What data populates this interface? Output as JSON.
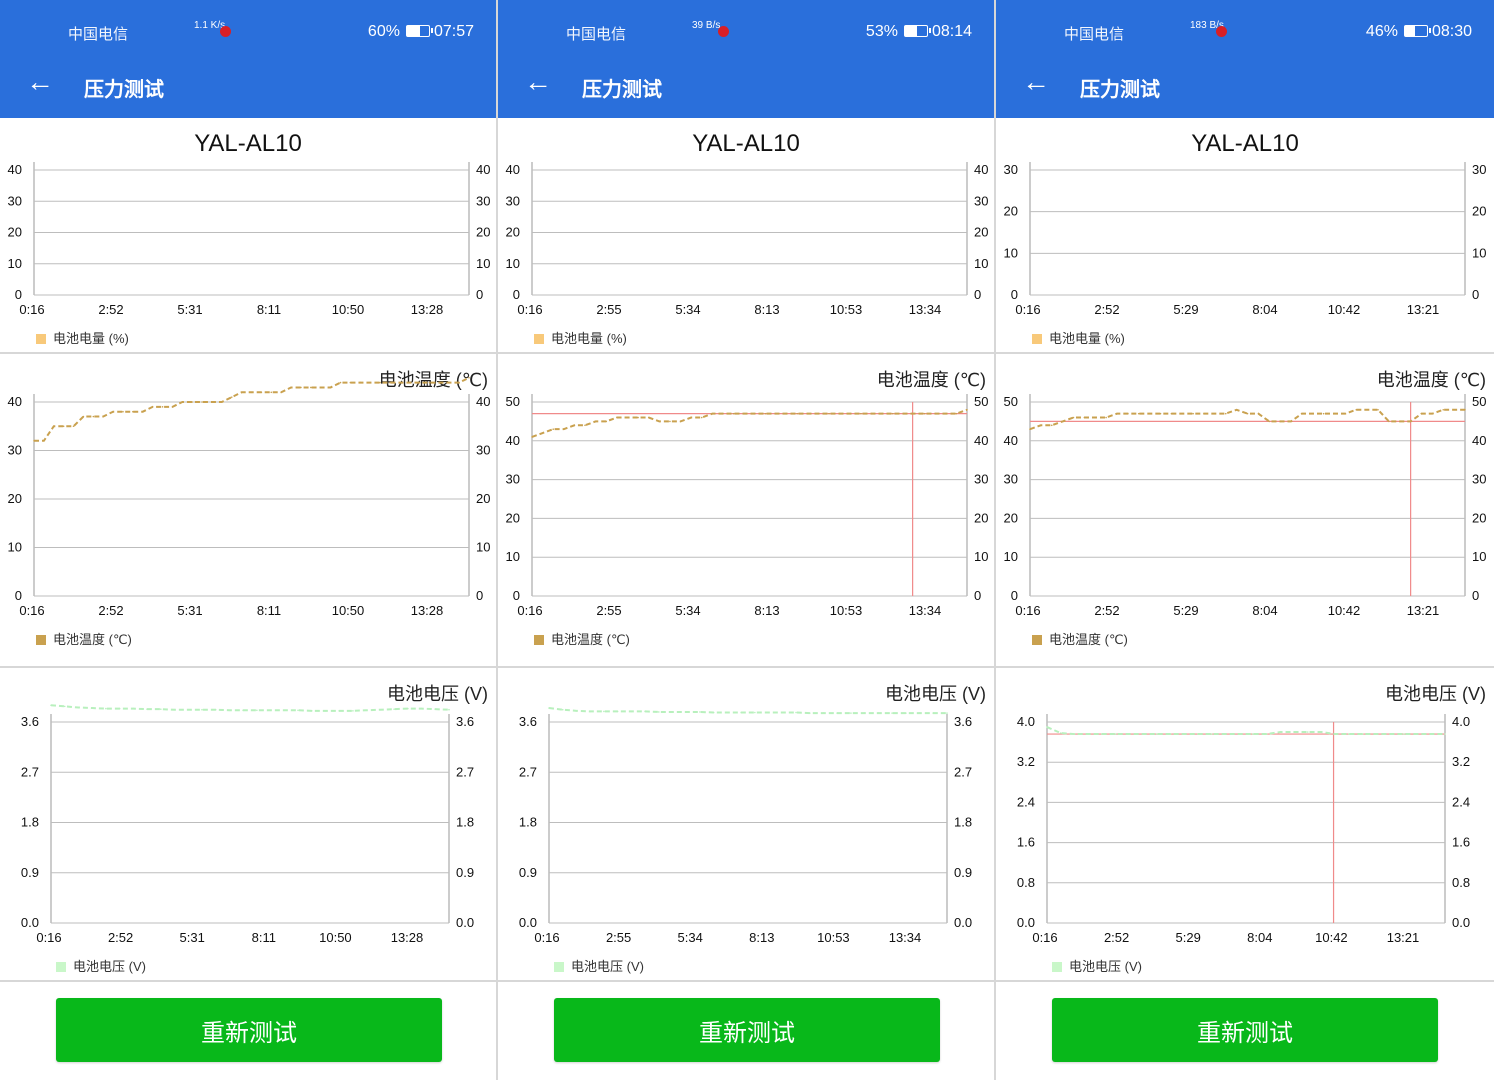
{
  "screens": [
    {
      "status": {
        "carrier": "中国电信",
        "network_speed": "1.1\nK/s",
        "battery": "60%",
        "time": "07:57"
      },
      "header": {
        "title": "压力测试"
      },
      "device": "YAL-AL10",
      "charts": [
        {
          "title": "",
          "legend": "电池电量 (%)",
          "legend_color": "#f8c97a",
          "line_color": "#f8c97a",
          "ylim": [
            0,
            40
          ],
          "ticks": [
            "0",
            "10",
            "20",
            "30",
            "40"
          ],
          "xlabels": [
            "0:16",
            "2:52",
            "5:31",
            "8:11",
            "10:50",
            "13:28"
          ],
          "values": []
        },
        {
          "title": "电池温度 (℃)",
          "legend": "电池温度 (℃)",
          "legend_color": "#c9a14f",
          "line_color": "#c9a14f",
          "ylim": [
            0,
            40
          ],
          "ticks": [
            "0",
            "10",
            "20",
            "30",
            "40"
          ],
          "xlabels": [
            "0:16",
            "2:52",
            "5:31",
            "8:11",
            "10:50",
            "13:28"
          ],
          "values": [
            32,
            32,
            35,
            35,
            35,
            37,
            37,
            37,
            38,
            38,
            38,
            38,
            39,
            39,
            39,
            40,
            40,
            40,
            40,
            40,
            41,
            42,
            42,
            42,
            42,
            42,
            43,
            43,
            43,
            43,
            43,
            44,
            44,
            44,
            44,
            44,
            44,
            44,
            44,
            44,
            44,
            44,
            44,
            44,
            45
          ]
        },
        {
          "title": "电池电压 (V)",
          "legend": "电池电压 (V)",
          "legend_color": "#c9f7c9",
          "line_color": "#b8f0bd",
          "ylim": [
            0,
            3.6
          ],
          "ticks": [
            "0.0",
            "0.9",
            "1.8",
            "2.7",
            "3.6"
          ],
          "xlabels": [
            "0:16",
            "2:52",
            "5:31",
            "8:11",
            "10:50",
            "13:28"
          ],
          "values": [
            3.9,
            3.88,
            3.86,
            3.85,
            3.84,
            3.84,
            3.84,
            3.83,
            3.83,
            3.82,
            3.82,
            3.82,
            3.82,
            3.81,
            3.81,
            3.81,
            3.81,
            3.81,
            3.81,
            3.8,
            3.8,
            3.8,
            3.8,
            3.81,
            3.82,
            3.83,
            3.84,
            3.84,
            3.83,
            3.82
          ]
        }
      ],
      "button": "重新测试"
    },
    {
      "status": {
        "carrier": "中国电信",
        "network_speed": "39\nB/s",
        "battery": "53%",
        "time": "08:14"
      },
      "header": {
        "title": "压力测试"
      },
      "device": "YAL-AL10",
      "charts": [
        {
          "title": "",
          "legend": "电池电量 (%)",
          "legend_color": "#f8c97a",
          "line_color": "#f8c97a",
          "ylim": [
            0,
            40
          ],
          "ticks": [
            "0",
            "10",
            "20",
            "30",
            "40"
          ],
          "xlabels": [
            "0:16",
            "2:55",
            "5:34",
            "8:13",
            "10:53",
            "13:34"
          ],
          "values": []
        },
        {
          "title": "电池温度 (℃)",
          "legend": "电池温度 (℃)",
          "legend_color": "#c9a14f",
          "line_color": "#c9a14f",
          "ylim": [
            0,
            50
          ],
          "ticks": [
            "0",
            "10",
            "20",
            "30",
            "40",
            "50"
          ],
          "xlabels": [
            "0:16",
            "2:55",
            "5:34",
            "8:13",
            "10:53",
            "13:34"
          ],
          "values": [
            41,
            42,
            43,
            43,
            44,
            44,
            45,
            45,
            46,
            46,
            46,
            46,
            45,
            45,
            45,
            46,
            46,
            47,
            47,
            47,
            47,
            47,
            47,
            47,
            47,
            47,
            47,
            47,
            47,
            47,
            47,
            47,
            47,
            47,
            47,
            47,
            47,
            47,
            47,
            47,
            47,
            48
          ],
          "ref_line": 47,
          "crosshair_x": 0.875
        },
        {
          "title": "电池电压 (V)",
          "legend": "电池电压 (V)",
          "legend_color": "#c9f7c9",
          "line_color": "#b8f0bd",
          "ylim": [
            0,
            3.6
          ],
          "ticks": [
            "0.0",
            "0.9",
            "1.8",
            "2.7",
            "3.6"
          ],
          "xlabels": [
            "0:16",
            "2:55",
            "5:34",
            "8:13",
            "10:53",
            "13:34"
          ],
          "values": [
            3.85,
            3.82,
            3.8,
            3.79,
            3.79,
            3.79,
            3.79,
            3.79,
            3.78,
            3.78,
            3.78,
            3.78,
            3.77,
            3.77,
            3.77,
            3.77,
            3.77,
            3.77,
            3.77,
            3.76,
            3.76,
            3.76,
            3.76,
            3.76,
            3.76,
            3.76,
            3.76,
            3.76,
            3.76,
            3.76
          ]
        }
      ],
      "button": "重新测试"
    },
    {
      "status": {
        "carrier": "中国电信",
        "network_speed": "183\nB/s",
        "battery": "46%",
        "time": "08:30"
      },
      "header": {
        "title": "压力测试"
      },
      "device": "YAL-AL10",
      "charts": [
        {
          "title": "",
          "legend": "电池电量 (%)",
          "legend_color": "#f8c97a",
          "line_color": "#f8c97a",
          "ylim": [
            0,
            30
          ],
          "ticks": [
            "0",
            "10",
            "20",
            "30"
          ],
          "xlabels": [
            "0:16",
            "2:52",
            "5:29",
            "8:04",
            "10:42",
            "13:21"
          ],
          "values": []
        },
        {
          "title": "电池温度 (℃)",
          "legend": "电池温度 (℃)",
          "legend_color": "#c9a14f",
          "line_color": "#c9a14f",
          "ylim": [
            0,
            50
          ],
          "ticks": [
            "0",
            "10",
            "20",
            "30",
            "40",
            "50"
          ],
          "xlabels": [
            "0:16",
            "2:52",
            "5:29",
            "8:04",
            "10:42",
            "13:21"
          ],
          "values": [
            43,
            44,
            44,
            45,
            46,
            46,
            46,
            46,
            47,
            47,
            47,
            47,
            47,
            47,
            47,
            47,
            47,
            47,
            47,
            48,
            47,
            47,
            45,
            45,
            45,
            47,
            47,
            47,
            47,
            47,
            48,
            48,
            48,
            45,
            45,
            45,
            47,
            47,
            48,
            48,
            48
          ],
          "ref_line": 45,
          "crosshair_x": 0.875
        },
        {
          "title": "电池电压 (V)",
          "legend": "电池电压 (V)",
          "legend_color": "#c9f7c9",
          "line_color": "#b8f0bd",
          "ylim": [
            0,
            4.0
          ],
          "ticks": [
            "0.0",
            "0.8",
            "1.6",
            "2.4",
            "3.2",
            "4.0"
          ],
          "xlabels": [
            "0:16",
            "2:52",
            "5:29",
            "8:04",
            "10:42",
            "13:21"
          ],
          "values": [
            3.9,
            3.78,
            3.76,
            3.76,
            3.76,
            3.76,
            3.76,
            3.76,
            3.76,
            3.76,
            3.76,
            3.76,
            3.76,
            3.76,
            3.76,
            3.76,
            3.76,
            3.8,
            3.8,
            3.8,
            3.8,
            3.76,
            3.76,
            3.76,
            3.76,
            3.76,
            3.76,
            3.76,
            3.76,
            3.76
          ],
          "ref_line": 3.76,
          "crosshair_x": 0.72
        }
      ],
      "button": "重新测试"
    }
  ]
}
